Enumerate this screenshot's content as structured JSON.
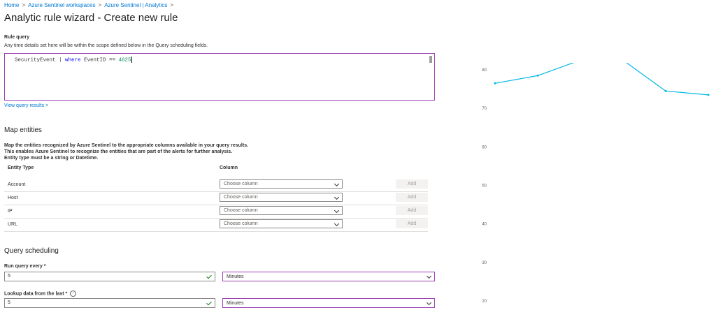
{
  "breadcrumb": [
    "Home",
    "Azure Sentinel workspaces",
    "Azure Sentinel | Analytics"
  ],
  "page_title": "Analytic rule wizard - Create new rule",
  "rule_query": {
    "label": "Rule query",
    "description": "Any time details set here will be within the scope defined below in the Query scheduling fields.",
    "code_plain": "SecurityEvent | ",
    "code_keyword": "where",
    "code_middle": " EventID == ",
    "code_number": "4625",
    "view_results_link": "View query results >"
  },
  "map_entities": {
    "heading": "Map entities",
    "desc1": "Map the entities recognized by Azure Sentinel to the appropriate columns available in your query results.",
    "desc2": "This enables Azure Sentinel to recognize the entities that are part of the alerts for further analysis.",
    "desc3": "Entity type must be a string or Datetime.",
    "col_entity_type": "Entity Type",
    "col_column": "Column",
    "rows": [
      {
        "type": "Account",
        "placeholder": "Choose column",
        "add": "Add"
      },
      {
        "type": "Host",
        "placeholder": "Choose column",
        "add": "Add"
      },
      {
        "type": "IP",
        "placeholder": "Choose column",
        "add": "Add"
      },
      {
        "type": "URL",
        "placeholder": "Choose column",
        "add": "Add"
      }
    ]
  },
  "query_scheduling": {
    "heading": "Query scheduling",
    "run_every_label": "Run query every *",
    "run_every_value": "5",
    "run_every_unit": "Minutes",
    "lookup_label": "Lookup data from the last *",
    "lookup_value": "5",
    "lookup_unit": "Minutes"
  },
  "colors": {
    "accent": "#0078d4",
    "focus": "#9a3fb5",
    "line": "#00b7e6"
  },
  "chart_data": {
    "type": "line",
    "title": "",
    "xlabel": "",
    "ylabel": "",
    "yticks": [
      80,
      70,
      60,
      50,
      40,
      30,
      20
    ],
    "ylim": [
      20,
      80
    ],
    "x": [
      0,
      1,
      2,
      3,
      4,
      5
    ],
    "values": [
      76.5,
      78.5,
      82.5,
      82.5,
      74.5,
      73.5
    ],
    "grid": false
  }
}
